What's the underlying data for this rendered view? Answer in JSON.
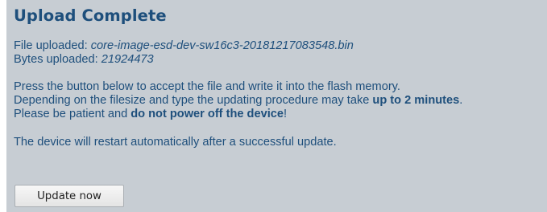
{
  "title": "Upload Complete",
  "file": {
    "label": "File uploaded: ",
    "value": "core-image-esd-dev-sw16c3-20181217083548.bin"
  },
  "bytes": {
    "label": "Bytes uploaded: ",
    "value": "21924473"
  },
  "instructions": {
    "line1": "Press the button below to accept the file and write it into the flash memory.",
    "line2_prefix": "Depending on the filesize and type the updating procedure may take ",
    "line2_bold": "up to 2 minutes",
    "line2_suffix": ".",
    "line3_prefix": "Please be patient and ",
    "line3_bold": "do not power off the device",
    "line3_suffix": "!"
  },
  "restart_note": "The device will restart automatically after a successful update.",
  "update_button_label": "Update now"
}
